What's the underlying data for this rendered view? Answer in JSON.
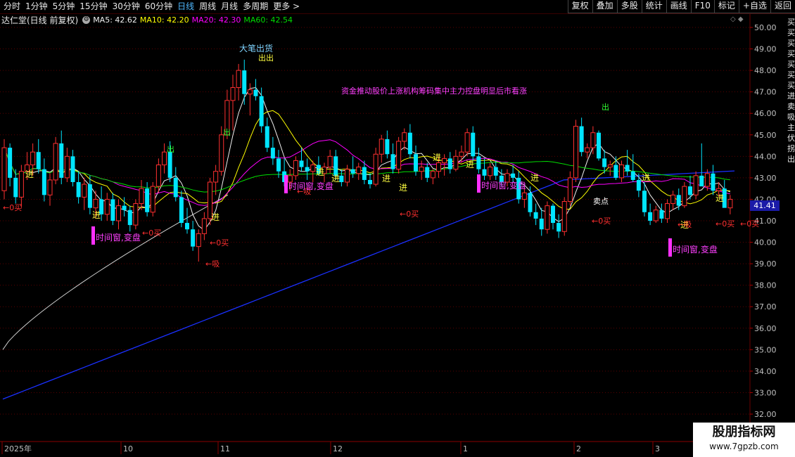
{
  "toolbar": {
    "periods": [
      "分时",
      "1分钟",
      "5分钟",
      "15分钟",
      "30分钟",
      "60分钟",
      "日线",
      "周线",
      "月线",
      "多周期",
      "更多 >"
    ],
    "active_period": "日线",
    "right_buttons": [
      "复权",
      "叠加",
      "多股",
      "统计",
      "画线",
      "F10",
      "标记",
      "+自选",
      "返回"
    ]
  },
  "info": {
    "stock_name": "达仁堂(日线 前复权)",
    "gear": "⚙",
    "ma5": "MA5: 42.62",
    "ma10": "MA10: 42.20",
    "ma20": "MA20: 42.30",
    "ma60": "MA60: 42.54",
    "chart_ctrl": "◇ ◆"
  },
  "colors": {
    "bg": "#000000",
    "up": "#ff3030",
    "down": "#00e5ff",
    "ma5": "#f0f0f0",
    "ma10": "#ffff00",
    "ma20": "#ff00ff",
    "ma60": "#00dd00",
    "long_ma": "#1a30ff",
    "long_ma2": "#cfcfcf",
    "grid": "#5a0000"
  },
  "price_axis": [
    "50.00",
    "49.00",
    "48.00",
    "47.00",
    "46.00",
    "45.00",
    "44.00",
    "43.00",
    "42.00",
    "41.00",
    "40.00",
    "39.00",
    "38.00",
    "37.00",
    "36.00",
    "35.00",
    "34.00",
    "33.00",
    "32.00"
  ],
  "current_price": "41.41",
  "date_axis": [
    "2025年",
    "10",
    "11",
    "12",
    "1",
    "2",
    "3"
  ],
  "side_text": "买买买买买买买进卖吸主伏拐出",
  "annotations": {
    "big_sell": "大笔出货",
    "sell": "出",
    "sell2": "出出",
    "long_text": "资金推动股价上涨机构筹码集中主力控盘明显后市看涨",
    "enter": "进",
    "buy": "←0买",
    "buy_left": "←0买",
    "absorb": "吸",
    "absorb2": "←吸",
    "window": "时间窗,变盘",
    "sell_point": "卖点"
  },
  "watermark": {
    "title": "股朋指标网",
    "url": "www.7gpzb.com"
  },
  "chart_data": {
    "type": "candlestick",
    "y_range": [
      31.5,
      50.3
    ],
    "candles_ohlc": [
      [
        42.4,
        44.8,
        42.0,
        44.4
      ],
      [
        44.4,
        44.6,
        42.6,
        43.0
      ],
      [
        43.0,
        43.4,
        41.8,
        42.1
      ],
      [
        42.1,
        43.6,
        41.6,
        43.3
      ],
      [
        43.3,
        44.2,
        42.9,
        43.6
      ],
      [
        43.6,
        44.6,
        43.1,
        44.2
      ],
      [
        44.2,
        44.8,
        43.2,
        43.4
      ],
      [
        43.4,
        43.9,
        41.9,
        42.2
      ],
      [
        42.2,
        43.2,
        41.7,
        42.9
      ],
      [
        42.9,
        44.9,
        42.7,
        44.6
      ],
      [
        44.6,
        45.2,
        42.7,
        43.0
      ],
      [
        43.0,
        44.4,
        42.8,
        44.0
      ],
      [
        44.0,
        44.3,
        42.6,
        42.8
      ],
      [
        42.8,
        43.3,
        41.8,
        42.1
      ],
      [
        42.1,
        43.0,
        41.5,
        42.7
      ],
      [
        42.7,
        43.1,
        41.3,
        41.6
      ],
      [
        41.6,
        42.4,
        41.1,
        42.0
      ],
      [
        42.0,
        42.6,
        41.0,
        41.3
      ],
      [
        41.3,
        42.3,
        41.0,
        42.0
      ],
      [
        42.0,
        42.3,
        40.8,
        41.0
      ],
      [
        41.0,
        42.0,
        40.6,
        41.7
      ],
      [
        41.7,
        42.1,
        41.2,
        41.5
      ],
      [
        41.5,
        41.7,
        40.5,
        40.8
      ],
      [
        40.8,
        42.0,
        40.6,
        41.8
      ],
      [
        41.8,
        42.9,
        41.5,
        42.5
      ],
      [
        42.5,
        42.8,
        41.2,
        41.4
      ],
      [
        41.4,
        42.8,
        41.2,
        42.6
      ],
      [
        42.6,
        43.9,
        42.3,
        43.6
      ],
      [
        43.6,
        44.6,
        43.2,
        44.2
      ],
      [
        44.2,
        44.7,
        42.8,
        43.0
      ],
      [
        43.0,
        43.5,
        41.9,
        42.1
      ],
      [
        42.1,
        42.4,
        40.7,
        40.9
      ],
      [
        40.9,
        41.6,
        40.4,
        40.6
      ],
      [
        40.6,
        41.0,
        39.6,
        39.8
      ],
      [
        39.8,
        40.6,
        39.1,
        40.4
      ],
      [
        40.4,
        41.4,
        40.1,
        41.1
      ],
      [
        41.1,
        43.0,
        40.8,
        42.8
      ],
      [
        42.8,
        43.6,
        42.2,
        43.3
      ],
      [
        43.3,
        45.4,
        43.1,
        45.0
      ],
      [
        45.0,
        47.1,
        44.8,
        46.6
      ],
      [
        46.6,
        47.8,
        45.2,
        47.2
      ],
      [
        47.2,
        48.3,
        46.6,
        48.0
      ],
      [
        48.0,
        48.5,
        46.4,
        46.9
      ],
      [
        46.9,
        47.4,
        45.9,
        47.1
      ],
      [
        47.1,
        47.6,
        46.6,
        46.8
      ],
      [
        46.8,
        47.2,
        45.1,
        45.4
      ],
      [
        45.4,
        45.8,
        44.2,
        44.4
      ],
      [
        44.4,
        44.9,
        43.6,
        43.9
      ],
      [
        43.9,
        44.3,
        43.0,
        43.3
      ],
      [
        43.3,
        43.9,
        42.6,
        42.8
      ],
      [
        42.8,
        43.4,
        42.4,
        43.1
      ],
      [
        43.1,
        44.0,
        42.9,
        43.8
      ],
      [
        43.8,
        44.4,
        43.3,
        43.5
      ],
      [
        43.5,
        43.9,
        42.9,
        43.3
      ],
      [
        43.3,
        43.8,
        42.8,
        43.6
      ],
      [
        43.6,
        44.0,
        43.1,
        43.2
      ],
      [
        43.2,
        43.7,
        42.8,
        43.5
      ],
      [
        43.5,
        44.3,
        43.2,
        44.0
      ],
      [
        44.0,
        44.3,
        42.9,
        43.1
      ],
      [
        43.1,
        43.4,
        42.6,
        42.8
      ],
      [
        42.8,
        43.6,
        42.6,
        43.4
      ],
      [
        43.4,
        44.0,
        43.0,
        43.2
      ],
      [
        43.2,
        43.7,
        42.9,
        43.5
      ],
      [
        43.5,
        43.8,
        42.7,
        42.9
      ],
      [
        42.9,
        43.2,
        42.5,
        42.7
      ],
      [
        42.7,
        44.4,
        42.6,
        44.1
      ],
      [
        44.1,
        45.0,
        43.7,
        44.8
      ],
      [
        44.8,
        45.2,
        43.9,
        44.1
      ],
      [
        44.1,
        44.6,
        43.2,
        43.4
      ],
      [
        43.4,
        44.9,
        43.2,
        44.7
      ],
      [
        44.7,
        45.3,
        44.3,
        45.1
      ],
      [
        45.1,
        45.5,
        43.9,
        44.1
      ],
      [
        44.1,
        44.5,
        43.1,
        43.3
      ],
      [
        43.3,
        43.8,
        42.9,
        43.5
      ],
      [
        43.5,
        43.7,
        42.8,
        43.0
      ],
      [
        43.0,
        43.4,
        42.7,
        43.3
      ],
      [
        43.3,
        44.0,
        43.0,
        43.7
      ],
      [
        43.7,
        44.1,
        43.1,
        43.9
      ],
      [
        43.9,
        44.2,
        43.2,
        43.4
      ],
      [
        43.4,
        44.3,
        43.3,
        44.0
      ],
      [
        44.0,
        44.5,
        43.7,
        44.2
      ],
      [
        44.2,
        45.3,
        44.0,
        45.1
      ],
      [
        45.1,
        45.4,
        43.8,
        44.0
      ],
      [
        44.0,
        44.4,
        43.2,
        43.4
      ],
      [
        43.4,
        43.9,
        42.9,
        43.1
      ],
      [
        43.1,
        43.7,
        42.9,
        43.5
      ],
      [
        43.5,
        43.8,
        42.9,
        43.1
      ],
      [
        43.1,
        43.4,
        42.6,
        42.8
      ],
      [
        42.8,
        43.4,
        42.6,
        43.2
      ],
      [
        43.2,
        43.6,
        42.8,
        43.0
      ],
      [
        43.0,
        43.3,
        41.8,
        42.0
      ],
      [
        42.0,
        42.6,
        41.6,
        42.3
      ],
      [
        42.3,
        42.6,
        41.2,
        41.4
      ],
      [
        41.4,
        41.8,
        40.8,
        41.1
      ],
      [
        41.1,
        41.6,
        40.3,
        40.6
      ],
      [
        40.6,
        41.9,
        40.4,
        41.7
      ],
      [
        41.7,
        41.8,
        40.6,
        40.9
      ],
      [
        40.9,
        41.3,
        40.2,
        40.5
      ],
      [
        40.5,
        42.1,
        40.3,
        41.9
      ],
      [
        41.9,
        43.3,
        41.7,
        43.0
      ],
      [
        43.0,
        45.7,
        42.8,
        45.4
      ],
      [
        45.4,
        45.8,
        44.0,
        44.2
      ],
      [
        44.2,
        44.6,
        43.9,
        44.4
      ],
      [
        44.4,
        45.4,
        44.1,
        45.1
      ],
      [
        45.1,
        45.2,
        43.8,
        43.9
      ],
      [
        43.9,
        44.3,
        43.2,
        43.5
      ],
      [
        43.5,
        43.8,
        43.1,
        43.6
      ],
      [
        43.6,
        44.0,
        42.9,
        43.0
      ],
      [
        43.0,
        43.8,
        42.8,
        43.6
      ],
      [
        43.6,
        44.3,
        43.1,
        43.3
      ],
      [
        43.3,
        44.1,
        42.8,
        42.9
      ],
      [
        42.9,
        43.2,
        42.1,
        42.4
      ],
      [
        42.4,
        42.8,
        41.2,
        41.4
      ],
      [
        41.4,
        41.8,
        40.8,
        41.0
      ],
      [
        41.0,
        41.7,
        40.9,
        41.5
      ],
      [
        41.5,
        41.8,
        40.9,
        41.1
      ],
      [
        41.1,
        42.0,
        40.9,
        41.8
      ],
      [
        41.8,
        42.4,
        41.5,
        42.2
      ],
      [
        42.2,
        42.5,
        41.5,
        41.7
      ],
      [
        41.7,
        42.8,
        41.6,
        42.6
      ],
      [
        42.6,
        43.1,
        42.0,
        42.2
      ],
      [
        42.2,
        43.3,
        42.0,
        43.1
      ],
      [
        43.1,
        44.6,
        42.9,
        42.6
      ],
      [
        42.6,
        43.4,
        42.4,
        43.2
      ],
      [
        43.2,
        43.6,
        42.2,
        42.4
      ],
      [
        42.4,
        42.8,
        42.1,
        42.5
      ],
      [
        42.5,
        42.9,
        42.0,
        41.6
      ],
      [
        41.6,
        42.2,
        41.3,
        42.0
      ]
    ],
    "ma_series": [
      {
        "name": "MA5",
        "last": 42.62
      },
      {
        "name": "MA10",
        "last": 42.2
      },
      {
        "name": "MA20",
        "last": 42.3
      },
      {
        "name": "MA60",
        "last": 42.54
      }
    ]
  }
}
